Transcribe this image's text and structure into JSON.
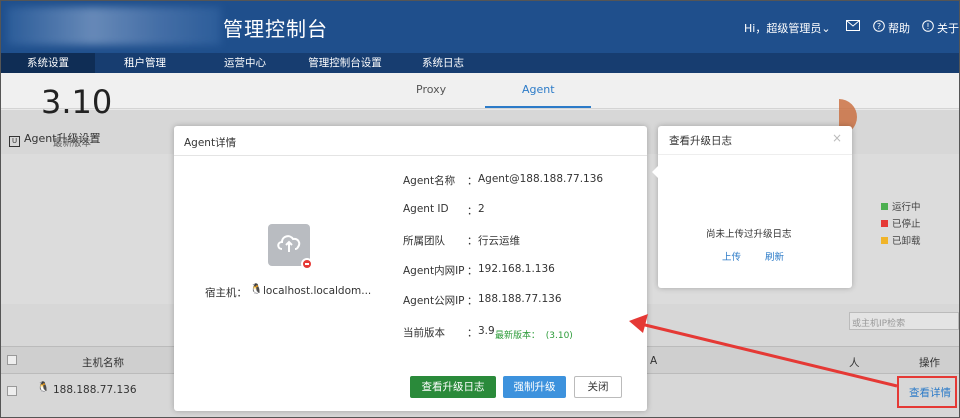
{
  "header": {
    "app_title": "管理控制台",
    "user_menu": "Hi，超级管理员",
    "help_label": "帮助",
    "about_label": "关于"
  },
  "nav": {
    "items": [
      "系统设置",
      "租户管理",
      "运营中心",
      "管理控制台设置",
      "系统日志"
    ],
    "active_index": 0
  },
  "subtabs": {
    "items": [
      "Proxy",
      "Agent"
    ],
    "active_index": 1
  },
  "page": {
    "section_title": "Agent升级设置",
    "big_version": "3.10",
    "big_version_label": "最新版本",
    "legend": [
      {
        "label": "运行中",
        "color": "#4caf50"
      },
      {
        "label": "已停止",
        "color": "#e53935"
      },
      {
        "label": "已卸载",
        "color": "#f0b429"
      }
    ],
    "search_placeholder": "或主机IP检索",
    "table_headers": {
      "hostname": "主机名称",
      "a_col": "A",
      "x_col": "人",
      "action": "操作"
    },
    "row": {
      "hostname": "188.188.77.136",
      "action_link": "查看详情"
    }
  },
  "modal": {
    "title": "Agent详情",
    "host_label": "宿主机：",
    "host_value": "localhost.localdom...",
    "fields": [
      {
        "label": "Agent名称",
        "value": "Agent@188.188.77.136"
      },
      {
        "label": "Agent ID",
        "value": "2"
      },
      {
        "label": "所属团队",
        "value": "行云运维"
      },
      {
        "label": "Agent内网IP",
        "value": "192.168.1.136"
      },
      {
        "label": "Agent公网IP",
        "value": "188.188.77.136"
      },
      {
        "label": "当前版本",
        "value": "3.9"
      }
    ],
    "colon": "：",
    "latest_label": "最新版本：",
    "latest_value": "(3.10)",
    "buttons": {
      "view_log": "查看升级日志",
      "force_upgrade": "强制升级",
      "close": "关闭"
    }
  },
  "popover": {
    "title": "查看升级日志",
    "close_glyph": "×",
    "empty_text": "尚未上传过升级日志",
    "upload": "上传",
    "refresh": "刷新"
  },
  "colors": {
    "header_bg": "#1f4f8c",
    "nav_bg": "#173d70",
    "accent": "#2c7bc8",
    "primary_green": "#2a8a3a",
    "annotation_red": "#e53935"
  }
}
